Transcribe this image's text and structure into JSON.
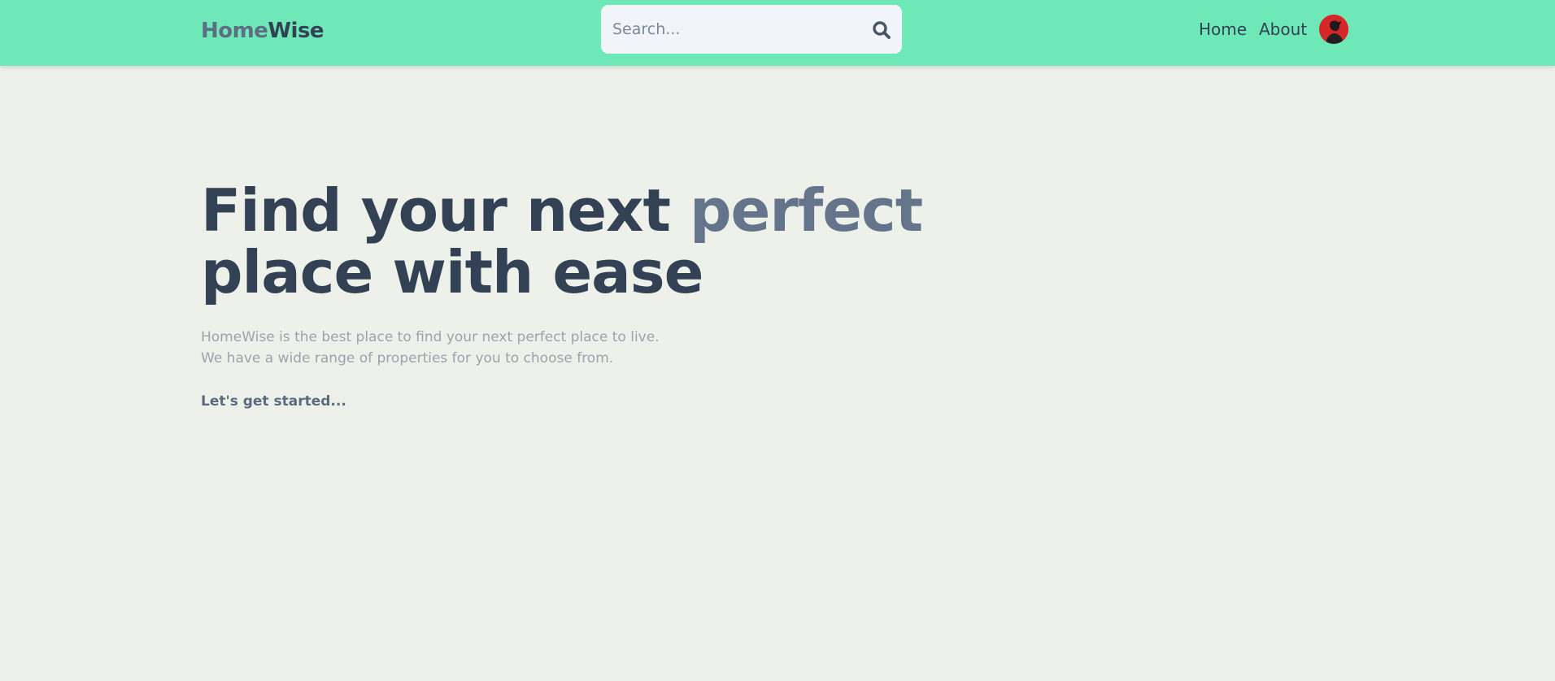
{
  "header": {
    "logo": {
      "part1": "Home",
      "part2": "Wise"
    },
    "search": {
      "placeholder": "Search...",
      "icon": "search-icon"
    },
    "nav": [
      {
        "label": "Home"
      },
      {
        "label": "About"
      }
    ],
    "avatar": {
      "icon": "user-avatar"
    }
  },
  "hero": {
    "title_main": "Find your next ",
    "title_accent": "perfect",
    "title_line2": "place with ease",
    "description_line1": "HomeWise is the best place to find your next perfect place to live.",
    "description_line2": "We have a wide range of properties for you to choose from.",
    "cta": "Let's get started..."
  },
  "colors": {
    "header_bg": "#6ee8b7",
    "page_bg": "#edf1e9",
    "text_dark": "#334155",
    "text_accent": "#64748b",
    "text_muted": "#9ca3af"
  }
}
